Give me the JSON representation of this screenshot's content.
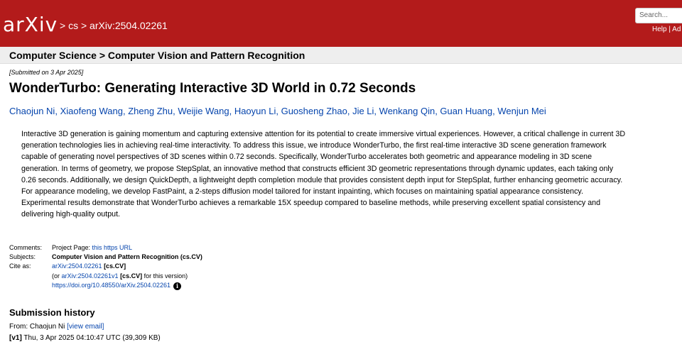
{
  "header": {
    "logo_text": "arXiv",
    "breadcrumb_sep1": ">",
    "breadcrumb_cs": "cs",
    "breadcrumb_sep2": ">",
    "breadcrumb_id": "arXiv:2504.02261",
    "search_placeholder": "Search...",
    "help_link": "Help | Ad",
    "brand_color": "#b31b1b"
  },
  "subheader": {
    "text": "Computer Science > Computer Vision and Pattern Recognition"
  },
  "paper": {
    "submitted": "[Submitted on 3 Apr 2025]",
    "title": "WonderTurbo: Generating Interactive 3D World in 0.72 Seconds",
    "authors": [
      "Chaojun Ni",
      "Xiaofeng Wang",
      "Zheng Zhu",
      "Weijie Wang",
      "Haoyun Li",
      "Guosheng Zhao",
      "Jie Li",
      "Wenkang Qin",
      "Guan Huang",
      "Wenjun Mei"
    ],
    "abstract_lines": [
      "Interactive 3D generation is gaining momentum and capturing extensive attention for its potential to create immersive virtual experiences. However, a critical challenge in current 3D",
      "generation technologies lies in achieving real-time interactivity. To address this issue, we introduce WonderTurbo, the first real-time interactive 3D scene generation framework",
      "capable of generating novel perspectives of 3D scenes within 0.72 seconds. Specifically, WonderTurbo accelerates both geometric and appearance modeling in 3D scene",
      "generation. In terms of geometry, we propose StepSplat, an innovative method that constructs efficient 3D geometric representations through dynamic updates, each taking only",
      "0.26 seconds. Additionally, we design QuickDepth, a lightweight depth completion module that provides consistent depth input for StepSplat, further enhancing geometric accuracy.",
      "For appearance modeling, we develop FastPaint, a 2-steps diffusion model tailored for instant inpainting, which focuses on maintaining spatial appearance consistency.",
      "Experimental results demonstrate that WonderTurbo achieves a remarkable 15X speedup compared to baseline methods, while preserving excellent spatial consistency and",
      "delivering high-quality output."
    ]
  },
  "metadata": {
    "comments_label": "Comments:",
    "comments_prefix": "Project Page: ",
    "comments_link": "this https URL",
    "subjects_label": "Subjects:",
    "subjects_value": "Computer Vision and Pattern Recognition (cs.CV)",
    "cite_label": "Cite as:",
    "cite_id": "arXiv:2504.02261",
    "cite_cat": " [cs.CV]",
    "version_open": "(or ",
    "version_id": "arXiv:2504.02261v1",
    "version_cat": " [cs.CV]",
    "version_close": " for this version)",
    "doi": "https://doi.org/10.48550/arXiv.2504.02261",
    "info_icon": "i"
  },
  "history": {
    "title": "Submission history",
    "from_prefix": "From: Chaojun Ni ",
    "view_email": "[view email]",
    "v1_label": "[v1]",
    "v1_text": " Thu, 3 Apr 2025 04:10:47 UTC (39,309 KB)"
  }
}
